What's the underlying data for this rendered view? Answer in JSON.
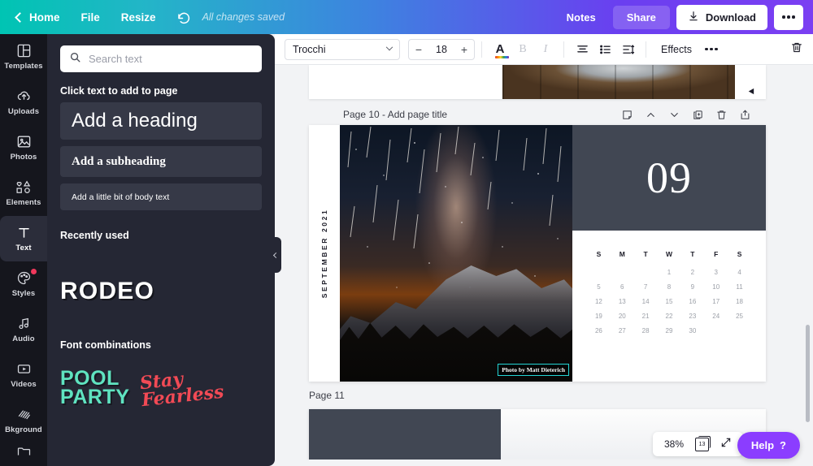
{
  "topbar": {
    "home_label": "Home",
    "file_label": "File",
    "resize_label": "Resize",
    "undo_icon": "undo-icon",
    "save_status": "All changes saved",
    "notes_label": "Notes",
    "share_label": "Share",
    "download_label": "Download",
    "download_icon": "download-icon",
    "more_icon": "more-horizontal-icon",
    "gradient_start": "#00c4b3",
    "gradient_end": "#7b3ff2"
  },
  "rail": {
    "items": [
      {
        "label": "Templates",
        "icon": "templates-icon",
        "active": false,
        "badge": false
      },
      {
        "label": "Uploads",
        "icon": "upload-cloud-icon",
        "active": false,
        "badge": false
      },
      {
        "label": "Photos",
        "icon": "photo-icon",
        "active": false,
        "badge": false
      },
      {
        "label": "Elements",
        "icon": "elements-shapes-icon",
        "active": false,
        "badge": false
      },
      {
        "label": "Text",
        "icon": "text-t-icon",
        "active": true,
        "badge": false
      },
      {
        "label": "Styles",
        "icon": "palette-icon",
        "active": false,
        "badge": true
      },
      {
        "label": "Audio",
        "icon": "music-note-icon",
        "active": false,
        "badge": false
      },
      {
        "label": "Videos",
        "icon": "video-play-icon",
        "active": false,
        "badge": false
      },
      {
        "label": "Bkground",
        "icon": "background-hatch-icon",
        "active": false,
        "badge": false
      }
    ],
    "badge_color": "#f0385b"
  },
  "panel": {
    "search": {
      "placeholder": "Search text",
      "value": "",
      "icon": "search-icon"
    },
    "click_to_add_label": "Click text to add to page",
    "text_cards": [
      {
        "label": "Add a heading"
      },
      {
        "label": "Add a subheading"
      },
      {
        "label": "Add a little bit of body text"
      }
    ],
    "recently_used_label": "Recently used",
    "recent_item": "RODEO",
    "font_combinations_label": "Font combinations",
    "combos": [
      {
        "line1": "POOL",
        "line2": "PARTY",
        "color": "#5fe3c0"
      },
      {
        "line1": "Stay",
        "line2": "Fearless",
        "color": "#f24a55"
      }
    ],
    "collapse_icon": "chevron-left-icon"
  },
  "toolbar": {
    "font_name": "Trocchi",
    "font_dropdown_icon": "chevron-down-icon",
    "size_decrease": "−",
    "font_size": "18",
    "size_increase": "+",
    "text_color_icon": "text-color-a-icon",
    "bold_label": "B",
    "italic_label": "I",
    "align_icon": "align-center-icon",
    "list_icon": "bullet-list-icon",
    "spacing_icon": "line-spacing-icon",
    "effects_label": "Effects",
    "more_icon": "more-horizontal-icon",
    "delete_icon": "trash-icon"
  },
  "canvas": {
    "page10": {
      "title": "Page 10 - Add page title",
      "icons": [
        "note-icon",
        "chevron-up-icon",
        "chevron-down-icon",
        "duplicate-icon",
        "trash-icon",
        "add-page-icon"
      ],
      "month_vertical": "SEPTEMBER 2021",
      "month_number": "09",
      "photo_credit": "Photo by Matt Dieterich",
      "dark_panel_color": "#414753",
      "calendar": {
        "dow": [
          "S",
          "M",
          "T",
          "W",
          "T",
          "F",
          "S"
        ],
        "weeks": [
          [
            "",
            "",
            "",
            "1",
            "2",
            "3",
            "4"
          ],
          [
            "5",
            "6",
            "7",
            "8",
            "9",
            "10",
            "11"
          ],
          [
            "12",
            "13",
            "14",
            "15",
            "16",
            "17",
            "18"
          ],
          [
            "19",
            "20",
            "21",
            "22",
            "23",
            "24",
            "25"
          ],
          [
            "26",
            "27",
            "28",
            "29",
            "30",
            "",
            ""
          ]
        ]
      }
    },
    "page11": {
      "title": "Page 11"
    }
  },
  "bottom": {
    "zoom_level": "38%",
    "page_count": "13",
    "page_count_icon": "pages-icon",
    "expand_icon": "expand-arrows-icon",
    "help_label": "Help",
    "help_mark": "?",
    "help_color": "#8b3dff"
  }
}
